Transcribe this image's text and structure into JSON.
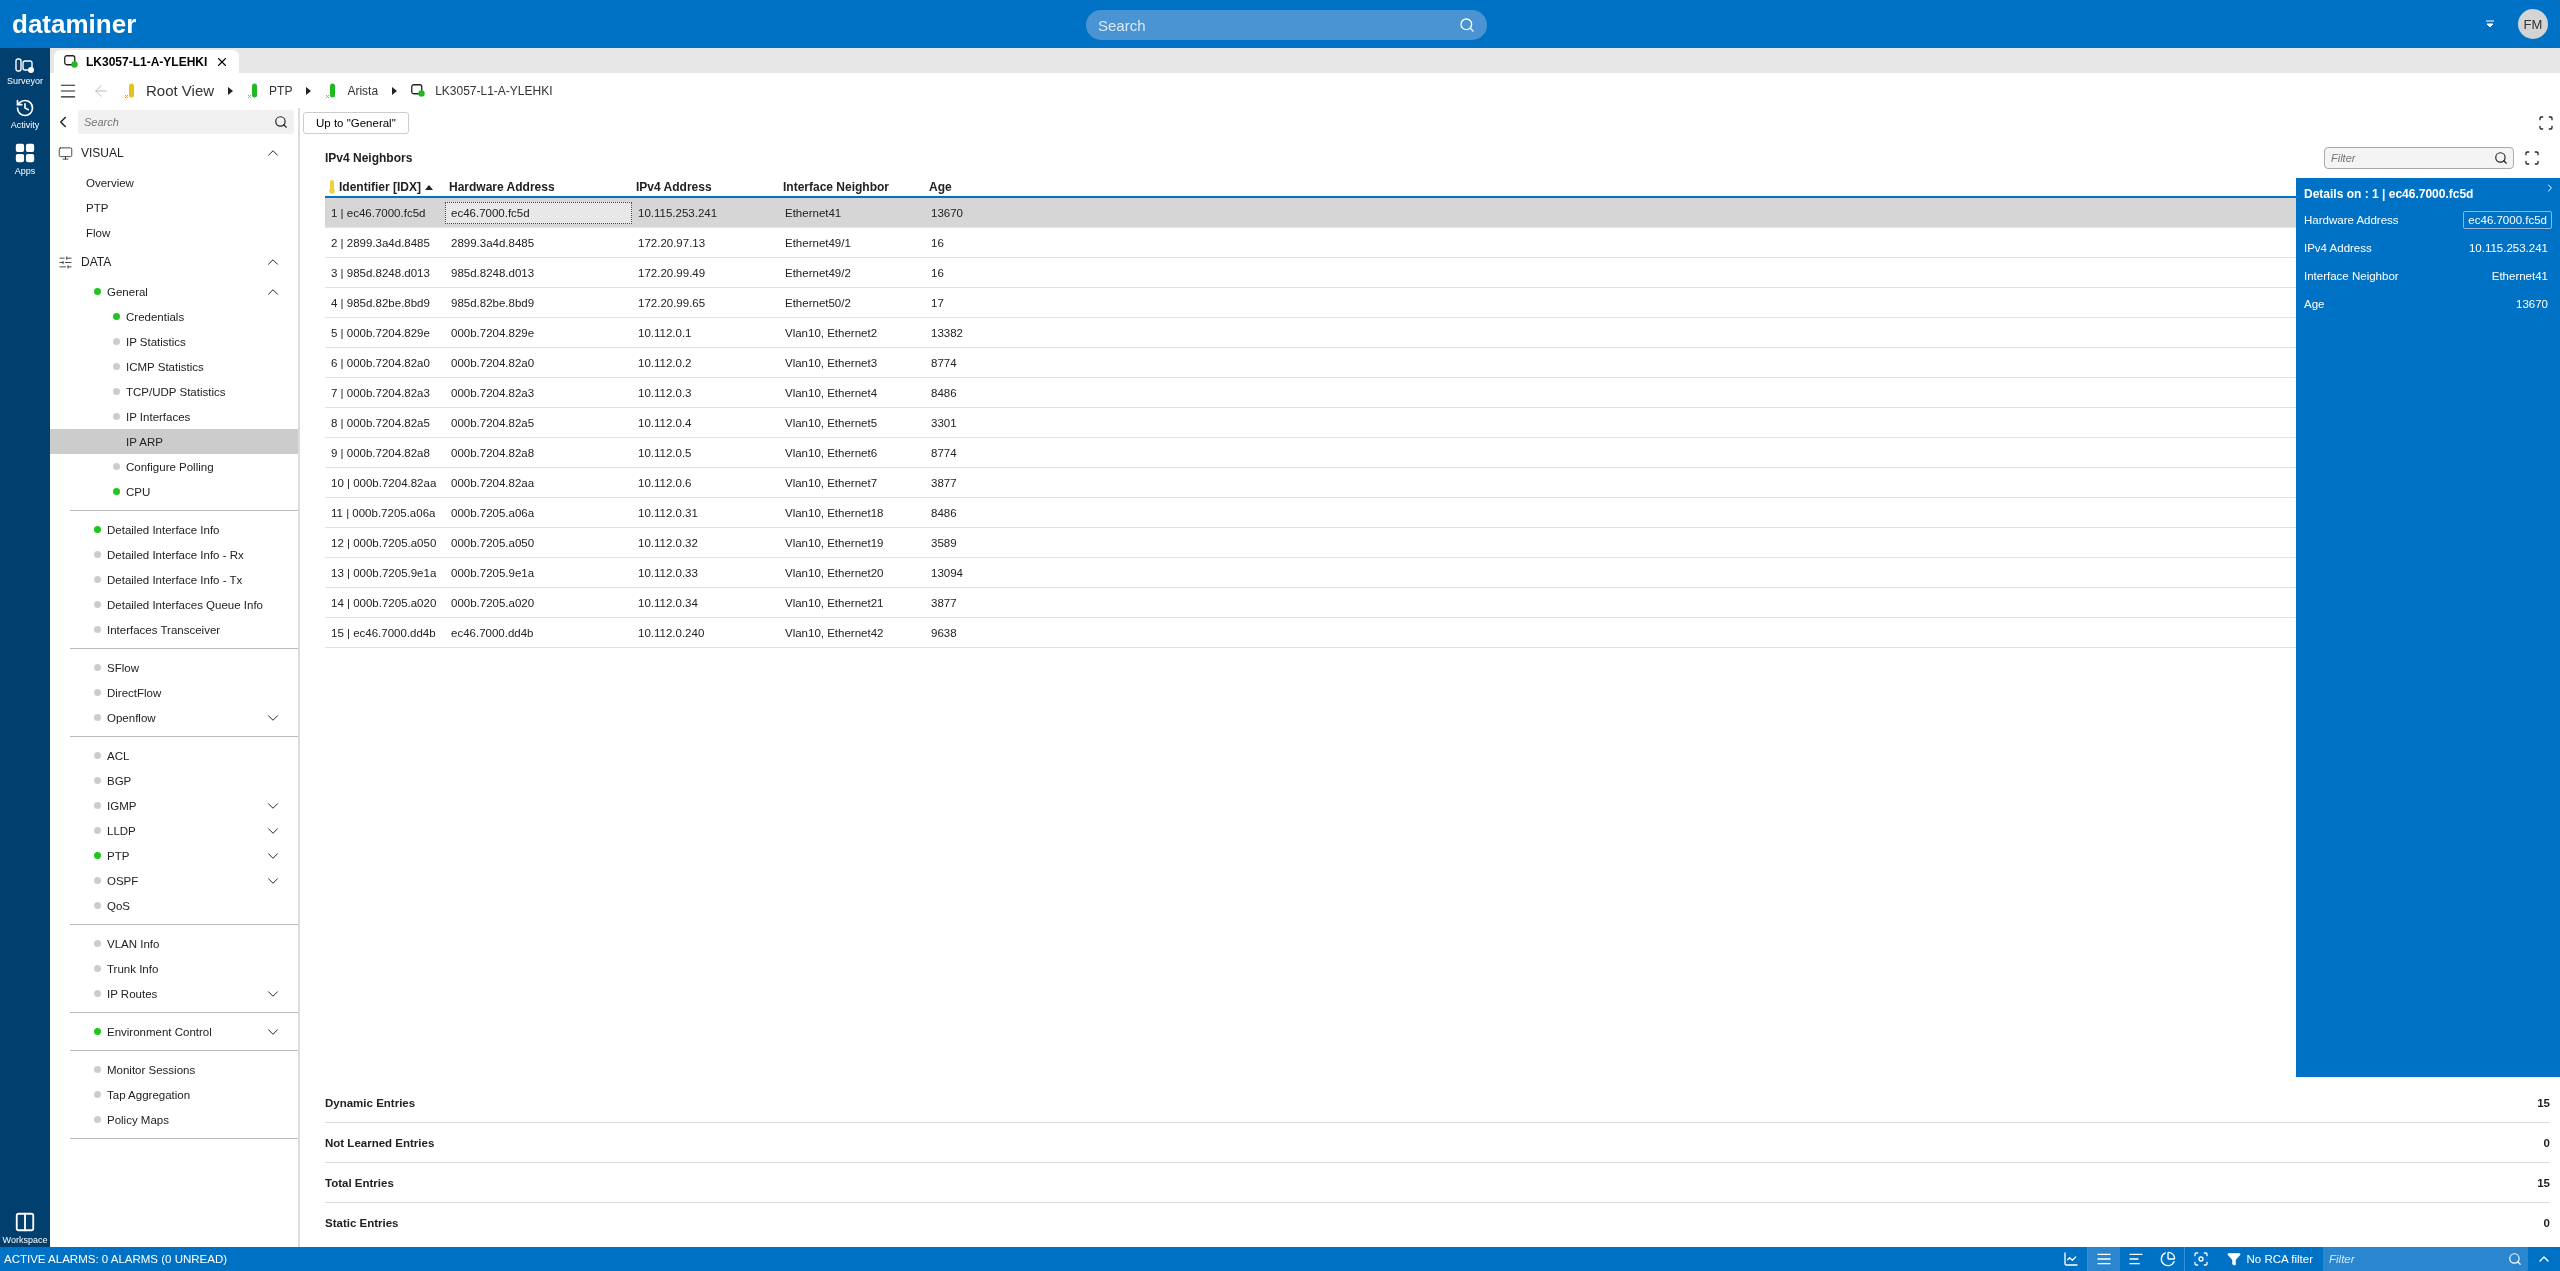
{
  "header": {
    "logo": "dataminer",
    "search": {
      "placeholder": "Search"
    },
    "avatar": "FM"
  },
  "rail": {
    "items": [
      {
        "label": "Surveyor",
        "kind": "surveyor"
      },
      {
        "label": "Activity",
        "kind": "activity"
      },
      {
        "label": "Apps",
        "kind": "apps"
      }
    ],
    "bottom": {
      "label": "Workspace",
      "kind": "workspace"
    }
  },
  "tabs": [
    {
      "label": "LK3057-L1-A-YLEHKI",
      "selected": true
    }
  ],
  "breadcrumb": [
    {
      "label": "Root View",
      "kind": "view",
      "color": "#e8c11a"
    },
    {
      "label": "PTP",
      "kind": "view",
      "color": "#22b822"
    },
    {
      "label": "Arista",
      "kind": "view",
      "color": "#22b822"
    },
    {
      "label": "LK3057-L1-A-YLEHKI",
      "kind": "element"
    }
  ],
  "sidebar": {
    "search": {
      "placeholder": "Search"
    },
    "sections": [
      {
        "title": "VISUAL",
        "kind": "visual",
        "expanded": true,
        "groups": [
          {
            "items": [
              {
                "label": "Overview",
                "selected": false
              },
              {
                "label": "PTP",
                "selected": false
              },
              {
                "label": "Flow",
                "selected": false
              }
            ]
          }
        ]
      },
      {
        "title": "DATA",
        "kind": "data",
        "expanded": true,
        "groups": [
          {
            "items": [
              {
                "label": "General",
                "color": "#22c41e",
                "selected": false,
                "expanded": true,
                "children": [
                  {
                    "label": "Credentials",
                    "color": "#22c41e",
                    "selected": false
                  },
                  {
                    "label": "IP Statistics",
                    "color": "#cccccc",
                    "selected": false
                  },
                  {
                    "label": "ICMP Statistics",
                    "color": "#cccccc",
                    "selected": false
                  },
                  {
                    "label": "TCP/UDP Statistics",
                    "color": "#cccccc",
                    "selected": false
                  },
                  {
                    "label": "IP Interfaces",
                    "color": "#cccccc",
                    "selected": false
                  },
                  {
                    "label": "IP ARP",
                    "selected": true
                  },
                  {
                    "label": "Configure Polling",
                    "color": "#cccccc",
                    "selected": false
                  },
                  {
                    "label": "CPU",
                    "color": "#22c41e",
                    "selected": false
                  }
                ]
              }
            ]
          },
          {
            "items": [
              {
                "label": "Detailed Interface Info",
                "color": "#22c41e",
                "selected": false
              },
              {
                "label": "Detailed Interface Info - Rx",
                "color": "#cccccc",
                "selected": false
              },
              {
                "label": "Detailed Interface Info - Tx",
                "color": "#cccccc",
                "selected": false
              },
              {
                "label": "Detailed Interfaces Queue Info",
                "color": "#cccccc",
                "selected": false
              },
              {
                "label": "Interfaces Transceiver",
                "color": "#cccccc",
                "selected": false
              }
            ]
          },
          {
            "items": [
              {
                "label": "SFlow",
                "color": "#cccccc",
                "selected": false
              },
              {
                "label": "DirectFlow",
                "color": "#cccccc",
                "selected": false
              },
              {
                "label": "Openflow",
                "color": "#cccccc",
                "selected": false,
                "expanded": false
              }
            ]
          },
          {
            "items": [
              {
                "label": "ACL",
                "color": "#cccccc",
                "selected": false
              },
              {
                "label": "BGP",
                "color": "#cccccc",
                "selected": false
              },
              {
                "label": "IGMP",
                "color": "#cccccc",
                "selected": false,
                "expanded": false
              },
              {
                "label": "LLDP",
                "color": "#cccccc",
                "selected": false,
                "expanded": false
              },
              {
                "label": "PTP",
                "color": "#22c41e",
                "selected": false,
                "expanded": false
              },
              {
                "label": "OSPF",
                "color": "#cccccc",
                "selected": false,
                "expanded": false
              },
              {
                "label": "QoS",
                "color": "#cccccc",
                "selected": false
              }
            ]
          },
          {
            "items": [
              {
                "label": "VLAN Info",
                "color": "#cccccc",
                "selected": false
              },
              {
                "label": "Trunk Info",
                "color": "#cccccc",
                "selected": false
              },
              {
                "label": "IP Routes",
                "color": "#cccccc",
                "selected": false,
                "expanded": false
              }
            ]
          },
          {
            "items": [
              {
                "label": "Environment Control",
                "color": "#22c41e",
                "selected": false,
                "expanded": false
              }
            ]
          },
          {
            "items": [
              {
                "label": "Monitor Sessions",
                "color": "#cccccc",
                "selected": false
              },
              {
                "label": "Tap Aggregation",
                "color": "#cccccc",
                "selected": false
              },
              {
                "label": "Policy Maps",
                "color": "#cccccc",
                "selected": false
              }
            ]
          }
        ]
      }
    ]
  },
  "toolbar": {
    "up_button": "Up to \"General\""
  },
  "table": {
    "title": "IPv4 Neighbors",
    "filter": {
      "placeholder": "Filter"
    },
    "columns": [
      {
        "label": "Identifier [IDX]",
        "primary_key": true,
        "sorted": true
      },
      {
        "label": "Hardware Address",
        "primary_key": false,
        "sorted": false
      },
      {
        "label": "IPv4 Address",
        "primary_key": false,
        "sorted": false
      },
      {
        "label": "Interface Neighbor",
        "primary_key": false,
        "sorted": false
      },
      {
        "label": "Age",
        "primary_key": false,
        "sorted": false
      }
    ],
    "rows": [
      {
        "cells": [
          "1 | ec46.7000.fc5d",
          "ec46.7000.fc5d",
          "10.115.253.241",
          "Ethernet41",
          "13670"
        ],
        "selected": true
      },
      {
        "cells": [
          "2 | 2899.3a4d.8485",
          "2899.3a4d.8485",
          "172.20.97.13",
          "Ethernet49/1",
          "16"
        ],
        "selected": false
      },
      {
        "cells": [
          "3 | 985d.8248.d013",
          "985d.8248.d013",
          "172.20.99.49",
          "Ethernet49/2",
          "16"
        ],
        "selected": false
      },
      {
        "cells": [
          "4 | 985d.82be.8bd9",
          "985d.82be.8bd9",
          "172.20.99.65",
          "Ethernet50/2",
          "17"
        ],
        "selected": false
      },
      {
        "cells": [
          "5 | 000b.7204.829e",
          "000b.7204.829e",
          "10.112.0.1",
          "Vlan10, Ethernet2",
          "13382"
        ],
        "selected": false
      },
      {
        "cells": [
          "6 | 000b.7204.82a0",
          "000b.7204.82a0",
          "10.112.0.2",
          "Vlan10, Ethernet3",
          "8774"
        ],
        "selected": false
      },
      {
        "cells": [
          "7 | 000b.7204.82a3",
          "000b.7204.82a3",
          "10.112.0.3",
          "Vlan10, Ethernet4",
          "8486"
        ],
        "selected": false
      },
      {
        "cells": [
          "8 | 000b.7204.82a5",
          "000b.7204.82a5",
          "10.112.0.4",
          "Vlan10, Ethernet5",
          "3301"
        ],
        "selected": false
      },
      {
        "cells": [
          "9 | 000b.7204.82a8",
          "000b.7204.82a8",
          "10.112.0.5",
          "Vlan10, Ethernet6",
          "8774"
        ],
        "selected": false
      },
      {
        "cells": [
          "10 | 000b.7204.82aa",
          "000b.7204.82aa",
          "10.112.0.6",
          "Vlan10, Ethernet7",
          "3877"
        ],
        "selected": false
      },
      {
        "cells": [
          "11 | 000b.7205.a06a",
          "000b.7205.a06a",
          "10.112.0.31",
          "Vlan10, Ethernet18",
          "8486"
        ],
        "selected": false
      },
      {
        "cells": [
          "12 | 000b.7205.a050",
          "000b.7205.a050",
          "10.112.0.32",
          "Vlan10, Ethernet19",
          "3589"
        ],
        "selected": false
      },
      {
        "cells": [
          "13 | 000b.7205.9e1a",
          "000b.7205.9e1a",
          "10.112.0.33",
          "Vlan10, Ethernet20",
          "13094"
        ],
        "selected": false
      },
      {
        "cells": [
          "14 | 000b.7205.a020",
          "000b.7205.a020",
          "10.112.0.34",
          "Vlan10, Ethernet21",
          "3877"
        ],
        "selected": false
      },
      {
        "cells": [
          "15 | ec46.7000.dd4b",
          "ec46.7000.dd4b",
          "10.112.0.240",
          "Vlan10, Ethernet42",
          "9638"
        ],
        "selected": false
      }
    ]
  },
  "details": {
    "title": "Details on : 1 | ec46.7000.fc5d",
    "fields": [
      {
        "label": "Hardware Address",
        "value": "ec46.7000.fc5d",
        "kind": "field"
      },
      {
        "label": "IPv4 Address",
        "value": "10.115.253.241",
        "kind": "text"
      },
      {
        "label": "Interface Neighbor",
        "value": "Ethernet41",
        "kind": "text"
      },
      {
        "label": "Age",
        "value": "13670",
        "kind": "text"
      }
    ]
  },
  "summary": [
    {
      "label": "Dynamic Entries",
      "value": "15"
    },
    {
      "label": "Not Learned Entries",
      "value": "0"
    },
    {
      "label": "Total Entries",
      "value": "15"
    },
    {
      "label": "Static Entries",
      "value": "0"
    }
  ],
  "status_bar": {
    "alarms": "ACTIVE ALARMS: 0 ALARMS (0 UNREAD)",
    "views": [
      {
        "kind": "trend",
        "selected": false
      },
      {
        "kind": "list",
        "selected": true
      },
      {
        "kind": "sort",
        "selected": false
      },
      {
        "kind": "pie",
        "selected": false
      }
    ],
    "rca": "No RCA filter",
    "filter": {
      "placeholder": "Filter"
    }
  }
}
